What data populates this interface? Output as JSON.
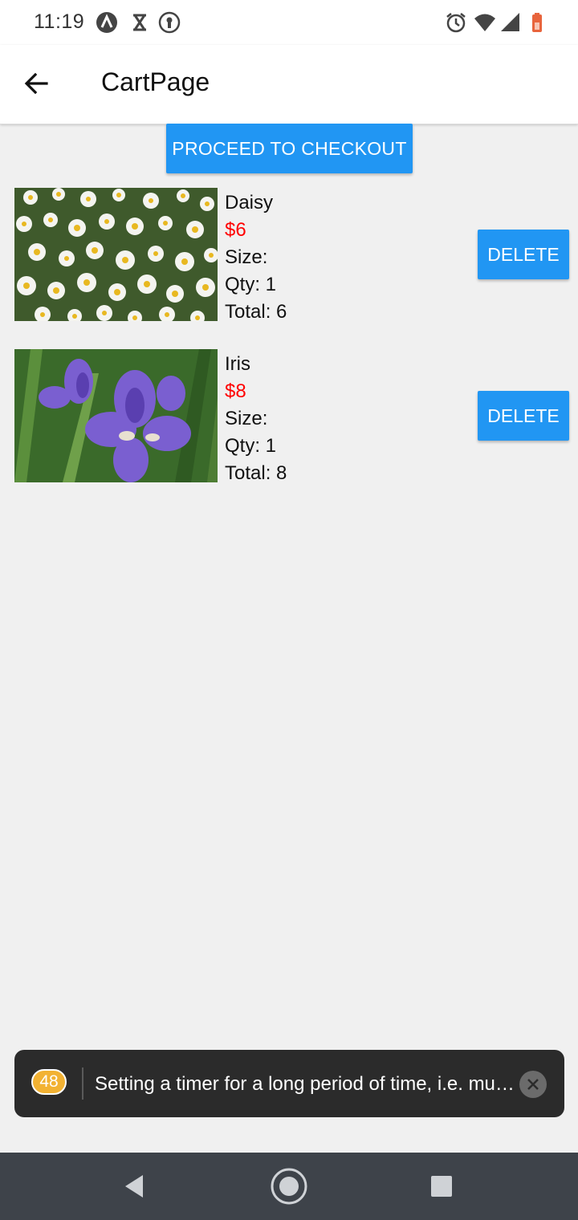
{
  "status_bar": {
    "time": "11:19",
    "left_icons": [
      "react-native-icon",
      "hourglass-icon",
      "keyhole-icon"
    ],
    "right_icons": [
      "alarm-icon",
      "wifi-icon",
      "cell-signal-icon",
      "battery-icon"
    ]
  },
  "app_bar": {
    "title": "CartPage"
  },
  "checkout": {
    "label": "PROCEED TO CHECKOUT"
  },
  "cart": {
    "items": [
      {
        "name": "Daisy",
        "price": "$6",
        "size": "Size:",
        "qty": "Qty: 1",
        "total": "Total: 6",
        "delete_label": "DELETE",
        "image_icon": "daisy-photo"
      },
      {
        "name": "Iris",
        "price": "$8",
        "size": "Size:",
        "qty": "Qty: 1",
        "total": "Total: 8",
        "delete_label": "DELETE",
        "image_icon": "iris-photo"
      }
    ]
  },
  "toast": {
    "count": "48",
    "message": "Setting a timer for a long period of time, i.e. multiple minutes, is a performance and correctness issue on Android"
  },
  "nav_bar": {
    "buttons": [
      "back-icon",
      "home-icon",
      "recents-icon"
    ]
  },
  "colors": {
    "accent": "#2196f3",
    "price": "#ff0000",
    "background": "#f0f0f0",
    "toast_bg": "#2b2b2b",
    "badge": "#f2b233",
    "navbar": "#3e434a"
  }
}
